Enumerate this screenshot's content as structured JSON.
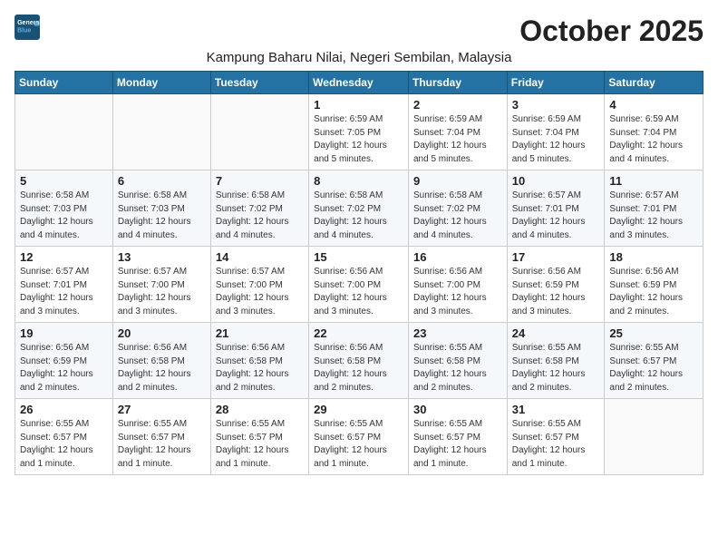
{
  "logo": {
    "line1": "General",
    "line2": "Blue"
  },
  "title": "October 2025",
  "location": "Kampung Baharu Nilai, Negeri Sembilan, Malaysia",
  "days_of_week": [
    "Sunday",
    "Monday",
    "Tuesday",
    "Wednesday",
    "Thursday",
    "Friday",
    "Saturday"
  ],
  "weeks": [
    [
      {
        "day": "",
        "info": ""
      },
      {
        "day": "",
        "info": ""
      },
      {
        "day": "",
        "info": ""
      },
      {
        "day": "1",
        "info": "Sunrise: 6:59 AM\nSunset: 7:05 PM\nDaylight: 12 hours\nand 5 minutes."
      },
      {
        "day": "2",
        "info": "Sunrise: 6:59 AM\nSunset: 7:04 PM\nDaylight: 12 hours\nand 5 minutes."
      },
      {
        "day": "3",
        "info": "Sunrise: 6:59 AM\nSunset: 7:04 PM\nDaylight: 12 hours\nand 5 minutes."
      },
      {
        "day": "4",
        "info": "Sunrise: 6:59 AM\nSunset: 7:04 PM\nDaylight: 12 hours\nand 4 minutes."
      }
    ],
    [
      {
        "day": "5",
        "info": "Sunrise: 6:58 AM\nSunset: 7:03 PM\nDaylight: 12 hours\nand 4 minutes."
      },
      {
        "day": "6",
        "info": "Sunrise: 6:58 AM\nSunset: 7:03 PM\nDaylight: 12 hours\nand 4 minutes."
      },
      {
        "day": "7",
        "info": "Sunrise: 6:58 AM\nSunset: 7:02 PM\nDaylight: 12 hours\nand 4 minutes."
      },
      {
        "day": "8",
        "info": "Sunrise: 6:58 AM\nSunset: 7:02 PM\nDaylight: 12 hours\nand 4 minutes."
      },
      {
        "day": "9",
        "info": "Sunrise: 6:58 AM\nSunset: 7:02 PM\nDaylight: 12 hours\nand 4 minutes."
      },
      {
        "day": "10",
        "info": "Sunrise: 6:57 AM\nSunset: 7:01 PM\nDaylight: 12 hours\nand 4 minutes."
      },
      {
        "day": "11",
        "info": "Sunrise: 6:57 AM\nSunset: 7:01 PM\nDaylight: 12 hours\nand 3 minutes."
      }
    ],
    [
      {
        "day": "12",
        "info": "Sunrise: 6:57 AM\nSunset: 7:01 PM\nDaylight: 12 hours\nand 3 minutes."
      },
      {
        "day": "13",
        "info": "Sunrise: 6:57 AM\nSunset: 7:00 PM\nDaylight: 12 hours\nand 3 minutes."
      },
      {
        "day": "14",
        "info": "Sunrise: 6:57 AM\nSunset: 7:00 PM\nDaylight: 12 hours\nand 3 minutes."
      },
      {
        "day": "15",
        "info": "Sunrise: 6:56 AM\nSunset: 7:00 PM\nDaylight: 12 hours\nand 3 minutes."
      },
      {
        "day": "16",
        "info": "Sunrise: 6:56 AM\nSunset: 7:00 PM\nDaylight: 12 hours\nand 3 minutes."
      },
      {
        "day": "17",
        "info": "Sunrise: 6:56 AM\nSunset: 6:59 PM\nDaylight: 12 hours\nand 3 minutes."
      },
      {
        "day": "18",
        "info": "Sunrise: 6:56 AM\nSunset: 6:59 PM\nDaylight: 12 hours\nand 2 minutes."
      }
    ],
    [
      {
        "day": "19",
        "info": "Sunrise: 6:56 AM\nSunset: 6:59 PM\nDaylight: 12 hours\nand 2 minutes."
      },
      {
        "day": "20",
        "info": "Sunrise: 6:56 AM\nSunset: 6:58 PM\nDaylight: 12 hours\nand 2 minutes."
      },
      {
        "day": "21",
        "info": "Sunrise: 6:56 AM\nSunset: 6:58 PM\nDaylight: 12 hours\nand 2 minutes."
      },
      {
        "day": "22",
        "info": "Sunrise: 6:56 AM\nSunset: 6:58 PM\nDaylight: 12 hours\nand 2 minutes."
      },
      {
        "day": "23",
        "info": "Sunrise: 6:55 AM\nSunset: 6:58 PM\nDaylight: 12 hours\nand 2 minutes."
      },
      {
        "day": "24",
        "info": "Sunrise: 6:55 AM\nSunset: 6:58 PM\nDaylight: 12 hours\nand 2 minutes."
      },
      {
        "day": "25",
        "info": "Sunrise: 6:55 AM\nSunset: 6:57 PM\nDaylight: 12 hours\nand 2 minutes."
      }
    ],
    [
      {
        "day": "26",
        "info": "Sunrise: 6:55 AM\nSunset: 6:57 PM\nDaylight: 12 hours\nand 1 minute."
      },
      {
        "day": "27",
        "info": "Sunrise: 6:55 AM\nSunset: 6:57 PM\nDaylight: 12 hours\nand 1 minute."
      },
      {
        "day": "28",
        "info": "Sunrise: 6:55 AM\nSunset: 6:57 PM\nDaylight: 12 hours\nand 1 minute."
      },
      {
        "day": "29",
        "info": "Sunrise: 6:55 AM\nSunset: 6:57 PM\nDaylight: 12 hours\nand 1 minute."
      },
      {
        "day": "30",
        "info": "Sunrise: 6:55 AM\nSunset: 6:57 PM\nDaylight: 12 hours\nand 1 minute."
      },
      {
        "day": "31",
        "info": "Sunrise: 6:55 AM\nSunset: 6:57 PM\nDaylight: 12 hours\nand 1 minute."
      },
      {
        "day": "",
        "info": ""
      }
    ]
  ]
}
